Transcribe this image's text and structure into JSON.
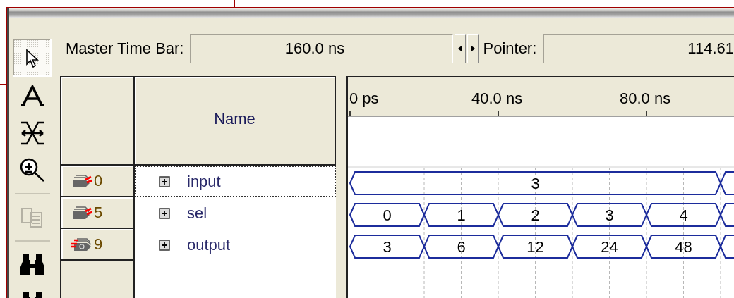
{
  "toolbar": {
    "master_label": "Master Time Bar:",
    "master_value": "160.0 ns",
    "pointer_label": "Pointer:",
    "pointer_value": "114.61"
  },
  "tool_groups": [
    [
      {
        "kind": "pointer",
        "selected": true,
        "disabled": false
      },
      {
        "kind": "text",
        "selected": false,
        "disabled": false
      },
      {
        "kind": "node",
        "selected": false,
        "disabled": false
      },
      {
        "kind": "zoom",
        "selected": false,
        "disabled": false
      }
    ],
    [
      {
        "kind": "copy",
        "selected": false,
        "disabled": true
      }
    ],
    [
      {
        "kind": "find",
        "selected": false,
        "disabled": false
      },
      {
        "kind": "find",
        "selected": false,
        "disabled": false
      }
    ]
  ],
  "name_header": "Name",
  "time_axis": [
    "0 ps",
    "40.0 ns",
    "80.0 ns"
  ],
  "signals": [
    {
      "kind": "input",
      "value": "0",
      "name": "input",
      "selected": true,
      "segments": [
        "3"
      ]
    },
    {
      "kind": "input",
      "value": "5",
      "name": "sel",
      "selected": false,
      "segments": [
        "0",
        "1",
        "2",
        "3",
        "4"
      ]
    },
    {
      "kind": "output",
      "value": "9",
      "name": "output",
      "selected": false,
      "segments": [
        "3",
        "6",
        "12",
        "24",
        "48"
      ]
    }
  ]
}
